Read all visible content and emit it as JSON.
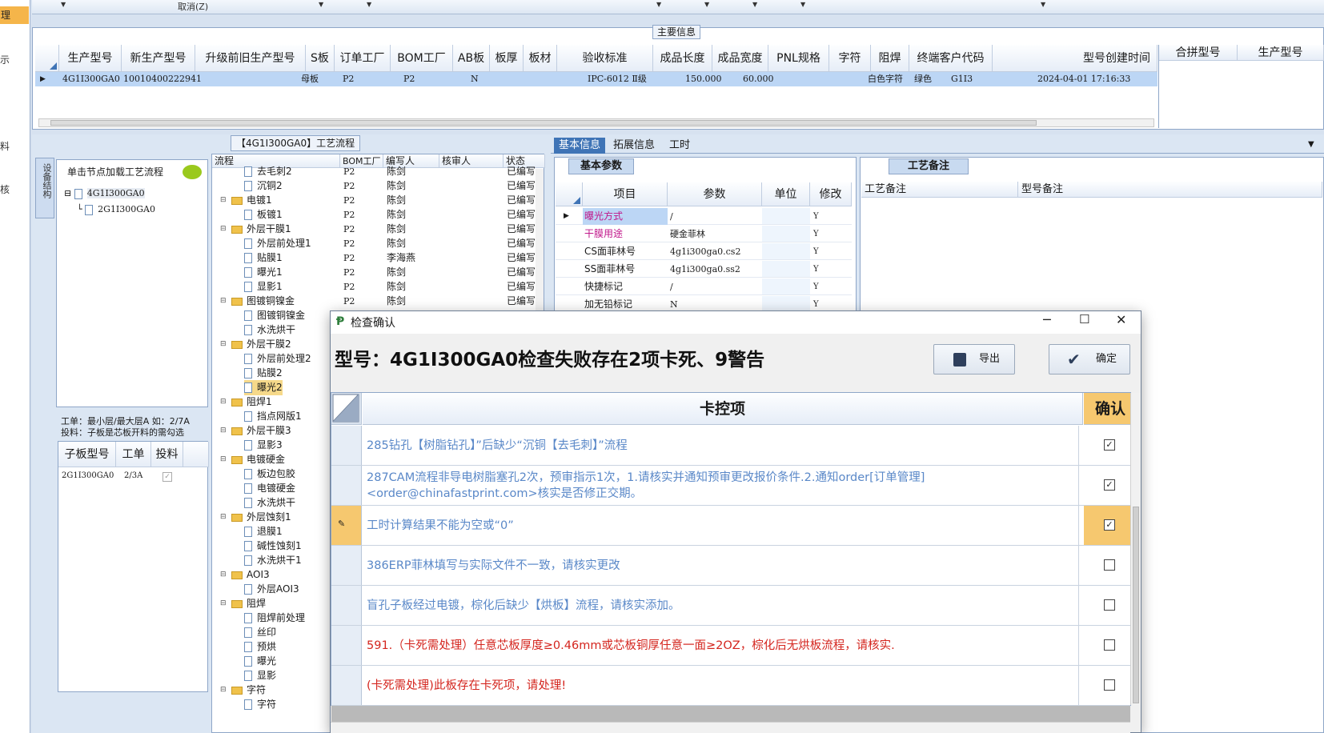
{
  "left_strip": {
    "selected": "理",
    "labels": [
      "示",
      "料",
      "核"
    ]
  },
  "toolbar": {
    "cancel_label": "取消(Z)"
  },
  "main_info": {
    "title": "主要信息",
    "columns": [
      "生产型号",
      "新生产型号",
      "升级前旧生产型号",
      "S板",
      "订单工厂",
      "BOM工厂",
      "AB板",
      "板厚",
      "板材",
      "验收标准",
      "成品长度",
      "成品宽度",
      "PNL规格",
      "字符",
      "阻焊",
      "终端客户代码",
      "型号创建时间"
    ],
    "row": {
      "model": "4G1I300GA0",
      "new_model": "10010400222941",
      "old_model": "",
      "s_board": "母板",
      "order_factory": "P2",
      "bom_factory": "P2",
      "ab_board": "N",
      "thickness": "",
      "material": "",
      "standard": "IPC-6012 Ⅱ级",
      "length": "150.000",
      "width": "60.000",
      "pnl": "",
      "char": "白色字符",
      "mask": "绿色",
      "customer": "G1I3",
      "created": "2024-04-01 17:16:33"
    },
    "merge_columns": [
      "合拼型号",
      "生产型号"
    ]
  },
  "flow_panel": {
    "title": "【4G1I300GA0】工艺流程",
    "side_tab": "设备结构",
    "hint": "单击节点加载工艺流程",
    "tree_root": "4G1I300GA0",
    "tree_child": "2G1I300GA0",
    "note1": "工单：最小层/最大层A 如：2/7A",
    "note2": "投料：子板是芯板开料的需勾选",
    "sub_columns": [
      "子板型号",
      "工单",
      "投料"
    ],
    "sub_row": {
      "model": "2G1I300GA0",
      "order": "2/3A"
    },
    "flow_columns": [
      "流程",
      "BOM工厂",
      "编写人",
      "核审人",
      "状态"
    ],
    "flow_rows": [
      {
        "type": "doc",
        "name": "去毛刺2",
        "bom": "P2",
        "author": "陈剑",
        "status": "已编写"
      },
      {
        "type": "doc",
        "name": "沉铜2",
        "bom": "P2",
        "author": "陈剑",
        "status": "已编写"
      },
      {
        "type": "folder",
        "name": "电镀1",
        "bom": "P2",
        "author": "陈剑",
        "status": "已编写"
      },
      {
        "type": "doc",
        "name": "板镀1",
        "bom": "P2",
        "author": "陈剑",
        "status": "已编写"
      },
      {
        "type": "folder",
        "name": "外层干膜1",
        "bom": "P2",
        "author": "陈剑",
        "status": "已编写"
      },
      {
        "type": "doc",
        "name": "外层前处理1",
        "bom": "P2",
        "author": "陈剑",
        "status": "已编写"
      },
      {
        "type": "doc",
        "name": "贴膜1",
        "bom": "P2",
        "author": "李海燕",
        "status": "已编写"
      },
      {
        "type": "doc",
        "name": "曝光1",
        "bom": "P2",
        "author": "陈剑",
        "status": "已编写"
      },
      {
        "type": "doc",
        "name": "显影1",
        "bom": "P2",
        "author": "陈剑",
        "status": "已编写"
      },
      {
        "type": "folder",
        "name": "图镀铜镍金",
        "bom": "P2",
        "author": "陈剑",
        "status": "已编写"
      },
      {
        "type": "doc",
        "name": "图镀铜镍金",
        "bom": "",
        "author": "",
        "status": ""
      },
      {
        "type": "doc",
        "name": "水洗烘干",
        "bom": "",
        "author": "",
        "status": ""
      },
      {
        "type": "folder",
        "name": "外层干膜2",
        "bom": "",
        "author": "",
        "status": ""
      },
      {
        "type": "doc",
        "name": "外层前处理2",
        "bom": "",
        "author": "",
        "status": ""
      },
      {
        "type": "doc",
        "name": "贴膜2",
        "bom": "",
        "author": "",
        "status": ""
      },
      {
        "type": "doc",
        "name": "曝光2",
        "bom": "",
        "author": "",
        "status": "",
        "highlight": true
      },
      {
        "type": "folder",
        "name": "阻焊1",
        "bom": "",
        "author": "",
        "status": ""
      },
      {
        "type": "doc",
        "name": "挡点网版1",
        "bom": "",
        "author": "",
        "status": ""
      },
      {
        "type": "folder",
        "name": "外层干膜3",
        "bom": "",
        "author": "",
        "status": ""
      },
      {
        "type": "doc",
        "name": "显影3",
        "bom": "",
        "author": "",
        "status": ""
      },
      {
        "type": "folder",
        "name": "电镀硬金",
        "bom": "",
        "author": "",
        "status": ""
      },
      {
        "type": "doc",
        "name": "板边包胶",
        "bom": "",
        "author": "",
        "status": ""
      },
      {
        "type": "doc",
        "name": "电镀硬金",
        "bom": "",
        "author": "",
        "status": ""
      },
      {
        "type": "doc",
        "name": "水洗烘干",
        "bom": "",
        "author": "",
        "status": ""
      },
      {
        "type": "folder",
        "name": "外层蚀刻1",
        "bom": "",
        "author": "",
        "status": ""
      },
      {
        "type": "doc",
        "name": "退膜1",
        "bom": "",
        "author": "",
        "status": ""
      },
      {
        "type": "doc",
        "name": "碱性蚀刻1",
        "bom": "",
        "author": "",
        "status": ""
      },
      {
        "type": "doc",
        "name": "水洗烘干1",
        "bom": "",
        "author": "",
        "status": ""
      },
      {
        "type": "folder",
        "name": "AOI3",
        "bom": "",
        "author": "",
        "status": ""
      },
      {
        "type": "doc",
        "name": "外层AOI3",
        "bom": "",
        "author": "",
        "status": ""
      },
      {
        "type": "folder",
        "name": "阻焊",
        "bom": "",
        "author": "",
        "status": ""
      },
      {
        "type": "doc",
        "name": "阻焊前处理",
        "bom": "",
        "author": "",
        "status": ""
      },
      {
        "type": "doc",
        "name": "丝印",
        "bom": "",
        "author": "",
        "status": ""
      },
      {
        "type": "doc",
        "name": "预烘",
        "bom": "",
        "author": "",
        "status": ""
      },
      {
        "type": "doc",
        "name": "曝光",
        "bom": "",
        "author": "",
        "status": ""
      },
      {
        "type": "doc",
        "name": "显影",
        "bom": "",
        "author": "",
        "status": ""
      },
      {
        "type": "folder",
        "name": "字符",
        "bom": "",
        "author": "",
        "status": ""
      },
      {
        "type": "doc",
        "name": "字符",
        "bom": "",
        "author": "",
        "status": ""
      }
    ]
  },
  "right_tabs": [
    "基本信息",
    "拓展信息",
    "工时"
  ],
  "basic_params": {
    "tab": "基本参数",
    "columns": [
      "项目",
      "参数",
      "单位",
      "修改"
    ],
    "rows": [
      {
        "item": "曝光方式",
        "value": "/",
        "modify": "Y",
        "item_color": "#c0168a",
        "selected": true
      },
      {
        "item": "干膜用途",
        "value": "硬金菲林",
        "modify": "Y",
        "item_color": "#c0168a"
      },
      {
        "item": "CS面菲林号",
        "value": "4g1i300ga0.cs2",
        "modify": "Y",
        "item_color": "#1a1a1a"
      },
      {
        "item": "SS面菲林号",
        "value": "4g1i300ga0.ss2",
        "modify": "Y",
        "item_color": "#1a1a1a"
      },
      {
        "item": "快捷标记",
        "value": "/",
        "modify": "Y",
        "item_color": "#1a1a1a"
      },
      {
        "item": "加无铅标记",
        "value": "N",
        "modify": "Y",
        "item_color": "#1a1a1a"
      }
    ]
  },
  "remarks": {
    "tab": "工艺备注",
    "columns": [
      "工艺备注",
      "型号备注"
    ]
  },
  "dialog": {
    "title": "检查确认",
    "headline": "型号：4G1I300GA0检查失败存在2项卡死、9警告",
    "export_label": "导出",
    "ok_label": "确定",
    "columns": [
      "卡控项",
      "确认"
    ],
    "rows": [
      {
        "text": "285钻孔【树脂钻孔】”后缺少“沉铜【去毛刺】”流程",
        "color": "blue",
        "checked": true
      },
      {
        "text": "287CAM流程非导电树脂塞孔2次，预审指示1次，1.请核实并通知预审更改报价条件.2.通知order[订单管理]<order@chinafastprint.com>核实是否修正交期。",
        "color": "blue",
        "checked": true
      },
      {
        "text": "工时计算结果不能为空或“0”",
        "color": "blue",
        "checked": true,
        "editing": true
      },
      {
        "text": "386ERP菲林填写与实际文件不一致，请核实更改",
        "color": "blue",
        "checked": false
      },
      {
        "text": "盲孔子板经过电镀，棕化后缺少【烘板】流程，请核实添加。",
        "color": "blue",
        "checked": false
      },
      {
        "text": "591.（卡死需处理）任意芯板厚度≥0.46mm或芯板铜厚任意一面≥2OZ，棕化后无烘板流程，请核实.",
        "color": "red",
        "checked": false
      },
      {
        "text": "(卡死需处理)此板存在卡死项，请处理!",
        "color": "red",
        "checked": false
      }
    ]
  }
}
